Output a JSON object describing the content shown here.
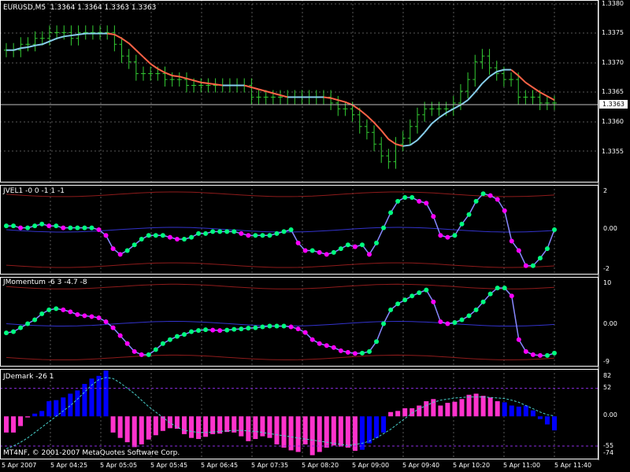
{
  "main_panel": {
    "title": "EURUSD,M5  1.3364 1.3364 1.3363 1.3363",
    "price_labels": [
      "1.3380",
      "1.3375",
      "1.3370",
      "1.3365",
      "1.3360",
      "1.3355"
    ],
    "current_price": "1.3363"
  },
  "jvel_panel": {
    "title": "JVEL1 -0 0 -1 1 -1",
    "levels": [
      "2",
      "0.00",
      "-2"
    ]
  },
  "jmomentum_panel": {
    "title": "JMomentum -6 3 -4.7 -8",
    "levels": [
      "10",
      "0.00",
      "-9"
    ]
  },
  "jdemark_panel": {
    "title": "JDemark -26 1",
    "levels": [
      "82",
      "52",
      "0.00",
      "-55",
      "-74"
    ]
  },
  "copyright": "MT4NF, © 2001-2007 MetaQuotes Software Corp.",
  "time_labels": [
    "5 Apr 2007",
    "5 Apr 04:25",
    "5 Apr 05:05",
    "5 Apr 05:45",
    "5 Apr 06:45",
    "5 Apr 07:35",
    "5 Apr 08:20",
    "5 Apr 09:00",
    "5 Apr 09:40",
    "5 Apr 10:20",
    "5 Apr 11:00",
    "5 Apr 11:40"
  ],
  "colors": {
    "background": "#000000",
    "grid": "#c0c0c0",
    "bars": "#33cc33",
    "ma_up": "#87ceeb",
    "ma_down": "#ff6347",
    "dot_up": "#00ff7f",
    "dot_down": "#ff00ff",
    "hist_up": "#0000ff",
    "hist_down": "#ff33cc",
    "bands": "#b22222"
  },
  "chart_data": [
    {
      "type": "line",
      "name": "EURUSD,M5 close",
      "ylim": [
        1.335,
        1.338
      ],
      "values": [
        1.3372,
        1.3372,
        1.3373,
        1.3373,
        1.3374,
        1.3374,
        1.3375,
        1.3375,
        1.3375,
        1.3374,
        1.3375,
        1.3375,
        1.3375,
        1.3375,
        1.3375,
        1.3373,
        1.3371,
        1.337,
        1.3368,
        1.3368,
        1.3368,
        1.3368,
        1.3367,
        1.3367,
        1.3367,
        1.3366,
        1.3366,
        1.3366,
        1.3366,
        1.3366,
        1.3366,
        1.3366,
        1.3366,
        1.3366,
        1.3364,
        1.3364,
        1.3364,
        1.3364,
        1.3364,
        1.3364,
        1.3364,
        1.3364,
        1.3364,
        1.3364,
        1.3364,
        1.3363,
        1.3362,
        1.3362,
        1.3361,
        1.3359,
        1.3358,
        1.3356,
        1.3354,
        1.3353,
        1.3356,
        1.3357,
        1.3359,
        1.3361,
        1.3362,
        1.3362,
        1.3362,
        1.3362,
        1.3363,
        1.3365,
        1.3367,
        1.337,
        1.3371,
        1.3369,
        1.3368,
        1.3367,
        1.3367,
        1.3364,
        1.3364,
        1.3364,
        1.3363,
        1.3363,
        1.3363
      ]
    },
    {
      "type": "line",
      "name": "JVEL1",
      "ylim": [
        -2.2,
        2.2
      ],
      "values": [
        0.2,
        0.2,
        0.1,
        0.1,
        0.2,
        0.3,
        0.2,
        0.2,
        0.1,
        0.1,
        0.1,
        0.1,
        0.1,
        0.0,
        -0.3,
        -1.0,
        -1.3,
        -1.1,
        -0.8,
        -0.5,
        -0.3,
        -0.3,
        -0.3,
        -0.4,
        -0.5,
        -0.5,
        -0.4,
        -0.2,
        -0.2,
        -0.1,
        -0.1,
        -0.1,
        -0.1,
        -0.2,
        -0.3,
        -0.3,
        -0.3,
        -0.3,
        -0.2,
        -0.1,
        0.0,
        -0.7,
        -1.1,
        -1.1,
        -1.2,
        -1.3,
        -1.2,
        -1.0,
        -0.8,
        -0.9,
        -0.8,
        -1.3,
        -0.7,
        0.1,
        0.9,
        1.5,
        1.7,
        1.7,
        1.5,
        1.4,
        0.7,
        -0.3,
        -0.4,
        -0.3,
        0.3,
        0.8,
        1.5,
        1.9,
        1.8,
        1.6,
        1.0,
        -0.6,
        -1.1,
        -1.9,
        -1.9,
        -1.5,
        -1.0,
        0.0
      ]
    },
    {
      "type": "line",
      "name": "JMomentum",
      "ylim": [
        -10,
        11
      ],
      "values": [
        -2.3,
        -2.0,
        -1.0,
        0.0,
        1.0,
        2.5,
        3.5,
        3.8,
        3.5,
        3.0,
        2.3,
        2.0,
        1.8,
        1.5,
        0.5,
        -1.0,
        -3.0,
        -5.0,
        -7.0,
        -7.8,
        -7.8,
        -6.5,
        -5.0,
        -4.0,
        -3.2,
        -2.7,
        -2.0,
        -1.7,
        -1.5,
        -1.6,
        -1.7,
        -1.6,
        -1.4,
        -1.3,
        -1.1,
        -1.0,
        -0.8,
        -0.6,
        -0.6,
        -0.6,
        -0.8,
        -1.3,
        -2.2,
        -4.0,
        -5.0,
        -5.5,
        -6.0,
        -6.8,
        -7.2,
        -7.5,
        -7.4,
        -7.0,
        -4.5,
        0.0,
        3.5,
        5.0,
        6.0,
        7.0,
        7.8,
        8.5,
        5.5,
        0.5,
        0.0,
        0.3,
        1.0,
        2.0,
        3.5,
        5.5,
        7.5,
        9.0,
        9.0,
        7.0,
        -4.0,
        -7.0,
        -7.8,
        -8.0,
        -8.0,
        -7.4
      ]
    },
    {
      "type": "bar",
      "name": "JDemark",
      "ylim": [
        -74,
        82
      ],
      "values": [
        -30,
        -30,
        -18,
        -2,
        5,
        10,
        28,
        30,
        35,
        42,
        48,
        60,
        70,
        75,
        85,
        -30,
        -40,
        -48,
        -57,
        -52,
        -43,
        -35,
        -27,
        -22,
        -23,
        -33,
        -40,
        -42,
        -38,
        -33,
        -32,
        -29,
        -30,
        -37,
        -46,
        -42,
        -37,
        -40,
        -52,
        -58,
        -63,
        -66,
        -52,
        -72,
        -66,
        -58,
        -54,
        -56,
        -58,
        -64,
        -62,
        -50,
        -40,
        -30,
        8,
        10,
        15,
        15,
        20,
        28,
        32,
        20,
        25,
        27,
        32,
        40,
        42,
        38,
        35,
        28,
        26,
        20,
        18,
        20,
        11,
        -5,
        -15,
        -26
      ]
    },
    {
      "type": "line",
      "name": "JDemark signal",
      "ylim": [
        -74,
        82
      ],
      "values": [
        -60,
        -55,
        -48,
        -40,
        -30,
        -20,
        -10,
        0,
        10,
        20,
        32,
        45,
        58,
        68,
        72,
        70,
        62,
        52,
        42,
        30,
        18,
        8,
        -2,
        -12,
        -20,
        -26,
        -28,
        -30,
        -30,
        -29,
        -28,
        -27,
        -26,
        -26,
        -27,
        -28,
        -30,
        -32,
        -34,
        -36,
        -38,
        -40,
        -42,
        -44,
        -46,
        -48,
        -50,
        -52,
        -54,
        -52,
        -50,
        -46,
        -40,
        -32,
        -24,
        -14,
        -4,
        6,
        14,
        20,
        26,
        30,
        32,
        34,
        35,
        36,
        36,
        36,
        35,
        34,
        33,
        30,
        26,
        20,
        14,
        8,
        3,
        1
      ]
    }
  ]
}
